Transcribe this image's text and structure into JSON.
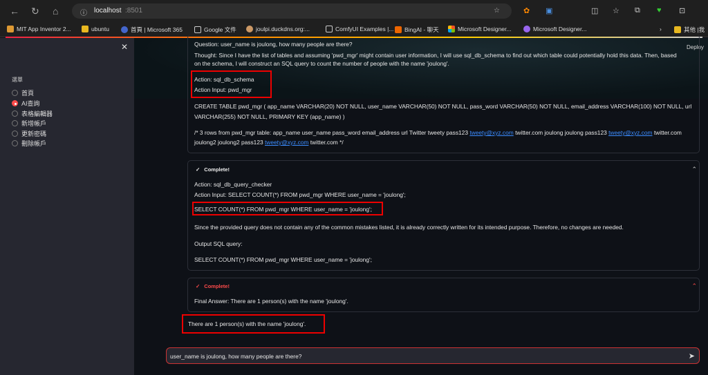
{
  "browser": {
    "url_host": "localhost",
    "url_port": ":8501",
    "bookmarks": [
      "MIT App Inventor 2...",
      "ubuntu",
      "首頁 | Microsoft 365",
      "Google 文件",
      "joulpi.duckdns.org:...",
      "ComfyUI Examples |...",
      "BingAI - 聊天",
      "Microsoft Designer...",
      "Microsoft Designer..."
    ],
    "other_bookmarks": "其他 |我"
  },
  "sidebar": {
    "menu_label": "選單",
    "options": [
      "首頁",
      "AI查詢",
      "表格編輯器",
      "新增帳戶",
      "更新密碼",
      "刪除帳戶"
    ],
    "selected": 1
  },
  "header": {
    "deploy": "Deploy"
  },
  "block1": {
    "question": "Question: user_name is joulong, how many people are there?",
    "thought1": "Thought: Since I have the list of tables and assuming 'pwd_mgr' might contain user information, I will use sql_db_schema to find out which table could potentially hold this data. Then, based",
    "thought2": "on the schema, I will construct an SQL query to count the number of people with the name 'joulong'.",
    "action": "Action: sql_db_schema",
    "action_input": "Action Input: pwd_mgr",
    "create1": "CREATE TABLE pwd_mgr ( app_name VARCHAR(20) NOT NULL, user_name VARCHAR(50) NOT NULL, pass_word VARCHAR(50) NOT NULL, email_address VARCHAR(100) NOT NULL, url",
    "create2": "VARCHAR(255) NOT NULL, PRIMARY KEY (app_name) )",
    "rows_a": "/* 3 rows from pwd_mgr table: app_name user_name pass_word email_address url Twitter tweety pass123 ",
    "email": "tweety@xyz.com",
    "rows_b": " twitter.com joulong joulong pass123 ",
    "rows_c": " twitter.com",
    "rows_d": "joulong2 joulong2 pass123 ",
    "rows_e": " twitter.com */"
  },
  "block2": {
    "status": "Complete!",
    "action": "Action: sql_db_query_checker",
    "action_input": "Action Input: SELECT COUNT(*) FROM pwd_mgr WHERE user_name = 'joulong';",
    "query": "SELECT COUNT(*) FROM pwd_mgr WHERE user_name = 'joulong';",
    "since": "Since the provided query does not contain any of the common mistakes listed, it is already correctly written for its intended purpose. Therefore, no changes are needed.",
    "output_label": "Output SQL query:",
    "output_query": "SELECT COUNT(*) FROM pwd_mgr WHERE user_name = 'joulong';"
  },
  "block3": {
    "status": "Complete!",
    "final": "Final Answer: There are 1 person(s) with the name 'joulong'."
  },
  "answer": "There are 1 person(s) with the name 'joulong'.",
  "chat": {
    "value": "user_name is joulong, how many people are there?"
  }
}
